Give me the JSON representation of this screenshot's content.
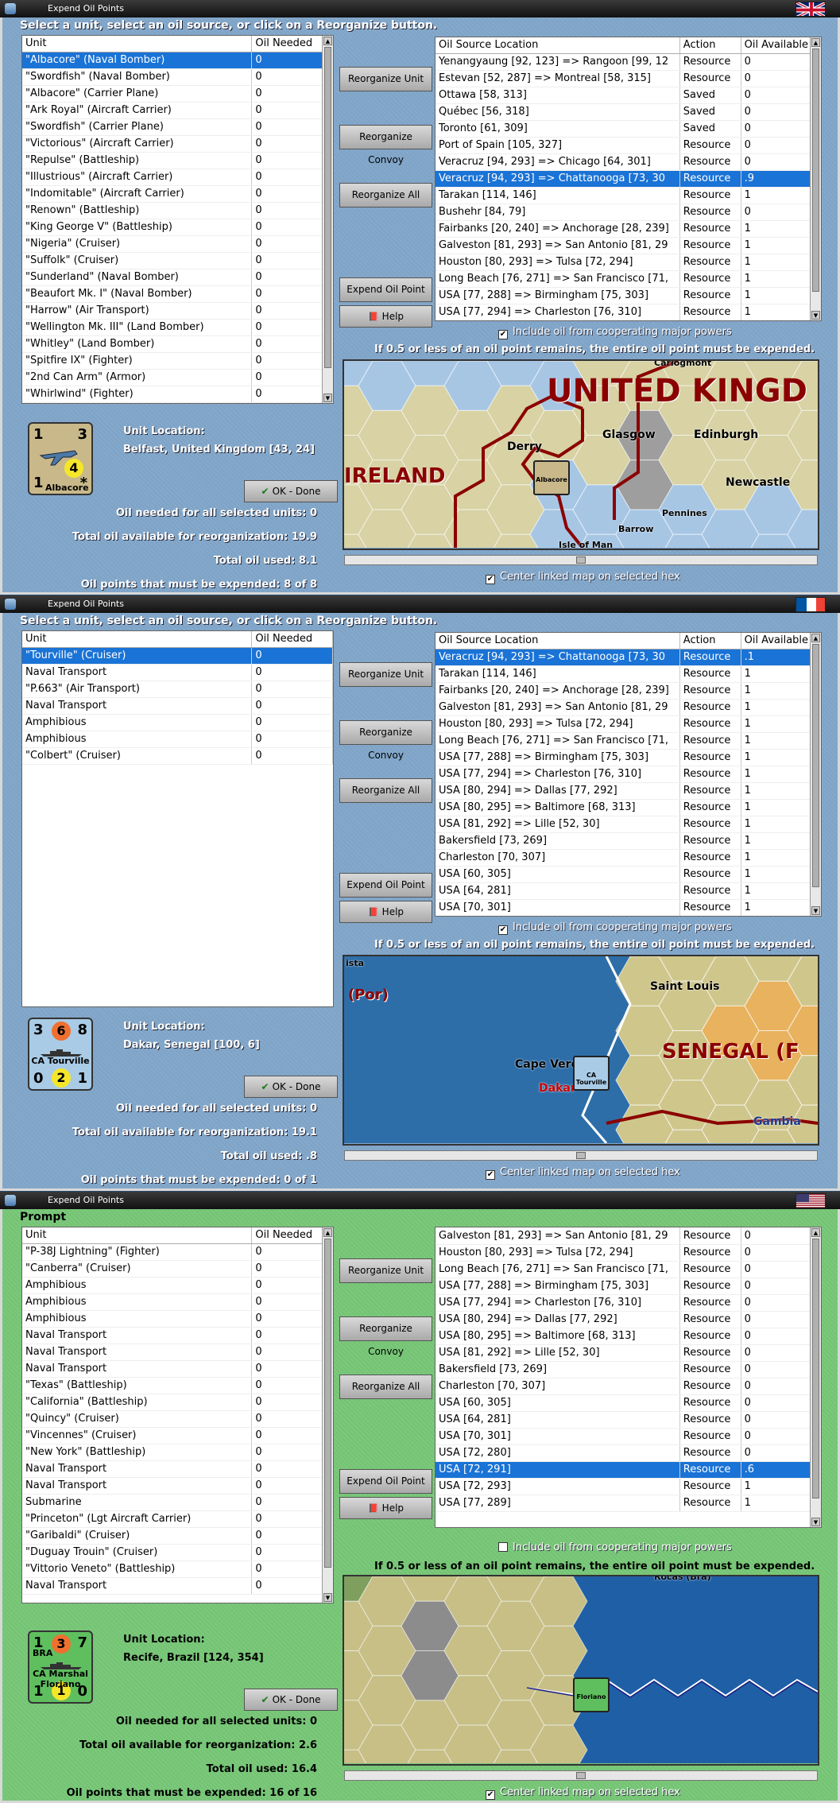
{
  "dialogs": [
    {
      "title": "Expend Oil Points",
      "flag": "uk",
      "prompt": "Select a unit, select an oil source, or click on a Reorganize button.",
      "unit_columns": [
        "Unit",
        "Oil Needed"
      ],
      "units": [
        [
          "\"Albacore\" (Naval Bomber)",
          "0"
        ],
        [
          "\"Swordfish\" (Naval Bomber)",
          "0"
        ],
        [
          "\"Albacore\" (Carrier Plane)",
          "0"
        ],
        [
          "\"Ark Royal\" (Aircraft Carrier)",
          "0"
        ],
        [
          "\"Swordfish\" (Carrier Plane)",
          "0"
        ],
        [
          "\"Victorious\" (Aircraft Carrier)",
          "0"
        ],
        [
          "\"Repulse\" (Battleship)",
          "0"
        ],
        [
          "\"Illustrious\" (Aircraft Carrier)",
          "0"
        ],
        [
          "\"Indomitable\" (Aircraft Carrier)",
          "0"
        ],
        [
          "\"Renown\" (Battleship)",
          "0"
        ],
        [
          "\"King George V\" (Battleship)",
          "0"
        ],
        [
          "\"Nigeria\" (Cruiser)",
          "0"
        ],
        [
          "\"Suffolk\" (Cruiser)",
          "0"
        ],
        [
          "\"Sunderland\" (Naval Bomber)",
          "0"
        ],
        [
          "\"Beaufort Mk. I\" (Naval Bomber)",
          "0"
        ],
        [
          "\"Harrow\" (Air Transport)",
          "0"
        ],
        [
          "\"Wellington Mk. III\" (Land Bomber)",
          "0"
        ],
        [
          "\"Whitley\" (Land Bomber)",
          "0"
        ],
        [
          "\"Spitfire IX\" (Fighter)",
          "0"
        ],
        [
          "\"2nd Can Arm\" (Armor)",
          "0"
        ],
        [
          "\"Whirlwind\" (Fighter)",
          "0"
        ]
      ],
      "selected_unit": 0,
      "source_columns": [
        "Oil Source Location",
        "Action",
        "Oil Available"
      ],
      "sources": [
        [
          "Yenangyaung [92, 123] => Rangoon [99, 12",
          "Resource",
          "0"
        ],
        [
          "Estevan [52, 287] => Montreal [58, 315]",
          "Resource",
          "0"
        ],
        [
          "Ottawa [58, 313]",
          "Saved",
          "0"
        ],
        [
          "Québec [56, 318]",
          "Saved",
          "0"
        ],
        [
          "Toronto [61, 309]",
          "Saved",
          "0"
        ],
        [
          "Port of Spain [105, 327]",
          "Resource",
          "0"
        ],
        [
          "Veracruz [94, 293] => Chicago [64, 301]",
          "Resource",
          "0"
        ],
        [
          "Veracruz [94, 293] => Chattanooga [73, 30",
          "Resource",
          ".9"
        ],
        [
          "Tarakan [114, 146]",
          "Resource",
          "1"
        ],
        [
          "Bushehr [84, 79]",
          "Resource",
          "0"
        ],
        [
          "Fairbanks [20, 240] => Anchorage [28, 239]",
          "Resource",
          "1"
        ],
        [
          "Galveston [81, 293] => San Antonio [81, 29",
          "Resource",
          "1"
        ],
        [
          "Houston [80, 293] => Tulsa [72, 294]",
          "Resource",
          "1"
        ],
        [
          "Long Beach [76, 271] => San Francisco [71,",
          "Resource",
          "1"
        ],
        [
          "USA [77, 288] => Birmingham [75, 303]",
          "Resource",
          "1"
        ],
        [
          "USA [77, 294] => Charleston [76, 310]",
          "Resource",
          "1"
        ]
      ],
      "selected_source": 7,
      "buttons": {
        "reorganize_unit": "Reorganize Unit",
        "reorganize_convoy": "Reorganize Convoy",
        "reorganize_all": "Reorganize All",
        "expend_oil_point": "Expend Oil Point",
        "help": "Help",
        "ok_done": "OK - Done"
      },
      "include_coop": {
        "label": "Include oil from cooperating major powers",
        "checked": true
      },
      "warning": "If 0.5 or less of an oil point remains, the entire oil point must be expended.",
      "center_map": {
        "label": "Center linked map on selected hex",
        "checked": true
      },
      "unit_location_label": "Unit Location:",
      "unit_location": "Belfast, United Kingdom [43, 24]",
      "counter": {
        "tl": "1",
        "tr": "3",
        "mid": "4",
        "bl": "1",
        "name": "Albacore",
        "br": "*",
        "color": "#c9b98a",
        "kind": "plane"
      },
      "stats": [
        {
          "label": "Oil needed for all selected units:",
          "value": "0"
        },
        {
          "label": "Total oil available for reorganization:",
          "value": "19.9"
        },
        {
          "label": "Total oil used:",
          "value": "8.1"
        },
        {
          "label": "Oil points that must be expended:",
          "value": "8 of 8"
        }
      ],
      "map_labels": {
        "big": "UNITED KINGD",
        "region": "IRELAND",
        "cities": [
          "Derry",
          "Glasgow",
          "Edinburgh",
          "Newcastle",
          "Pennines",
          "Barrow",
          "Isle of Man",
          "Carlogmont"
        ],
        "counter_name": "Albacore"
      }
    },
    {
      "title": "Expend Oil Points",
      "flag": "france",
      "prompt": "Select a unit, select an oil source, or click on a Reorganize button.",
      "unit_columns": [
        "Unit",
        "Oil Needed"
      ],
      "units": [
        [
          "\"Tourville\" (Cruiser)",
          "0"
        ],
        [
          "Naval Transport",
          "0"
        ],
        [
          "\"P.663\" (Air Transport)",
          "0"
        ],
        [
          "Naval Transport",
          "0"
        ],
        [
          "Amphibious",
          "0"
        ],
        [
          "Amphibious",
          "0"
        ],
        [
          "\"Colbert\" (Cruiser)",
          "0"
        ]
      ],
      "selected_unit": 0,
      "source_columns": [
        "Oil Source Location",
        "Action",
        "Oil Available"
      ],
      "sources": [
        [
          "Veracruz [94, 293] => Chattanooga [73, 30",
          "Resource",
          ".1"
        ],
        [
          "Tarakan [114, 146]",
          "Resource",
          "1"
        ],
        [
          "Fairbanks [20, 240] => Anchorage [28, 239]",
          "Resource",
          "1"
        ],
        [
          "Galveston [81, 293] => San Antonio [81, 29",
          "Resource",
          "1"
        ],
        [
          "Houston [80, 293] => Tulsa [72, 294]",
          "Resource",
          "1"
        ],
        [
          "Long Beach [76, 271] => San Francisco [71,",
          "Resource",
          "1"
        ],
        [
          "USA [77, 288] => Birmingham [75, 303]",
          "Resource",
          "1"
        ],
        [
          "USA [77, 294] => Charleston [76, 310]",
          "Resource",
          "1"
        ],
        [
          "USA [80, 294] => Dallas [77, 292]",
          "Resource",
          "1"
        ],
        [
          "USA [80, 295] => Baltimore [68, 313]",
          "Resource",
          "1"
        ],
        [
          "USA [81, 292] => Lille [52, 30]",
          "Resource",
          "1"
        ],
        [
          "Bakersfield [73, 269]",
          "Resource",
          "1"
        ],
        [
          "Charleston [70, 307]",
          "Resource",
          "1"
        ],
        [
          "USA [60, 305]",
          "Resource",
          "1"
        ],
        [
          "USA [64, 281]",
          "Resource",
          "1"
        ],
        [
          "USA [70, 301]",
          "Resource",
          "1"
        ]
      ],
      "selected_source": 0,
      "buttons": {
        "reorganize_unit": "Reorganize Unit",
        "reorganize_convoy": "Reorganize Convoy",
        "reorganize_all": "Reorganize All",
        "expend_oil_point": "Expend Oil Point",
        "help": "Help",
        "ok_done": "OK - Done"
      },
      "include_coop": {
        "label": "Include oil from cooperating major powers",
        "checked": true
      },
      "warning": "If 0.5 or less of an oil point remains, the entire oil point must be expended.",
      "center_map": {
        "label": "Center linked map on selected hex",
        "checked": true
      },
      "unit_location_label": "Unit Location:",
      "unit_location": "Dakar, Senegal [100, 6]",
      "counter": {
        "tl": "3",
        "tr": "8",
        "mid": "6",
        "bl": "0",
        "name": "CA Tourville",
        "br": "1",
        "mid2": "2",
        "color": "#a9cbe6",
        "kind": "ship"
      },
      "stats": [
        {
          "label": "Oil needed for all selected units:",
          "value": "0"
        },
        {
          "label": "Total oil available for reorganization:",
          "value": "19.1"
        },
        {
          "label": "Total oil used:",
          "value": ".8"
        },
        {
          "label": "Oil points that must be expended:",
          "value": "0 of 1"
        }
      ],
      "map_labels": {
        "big": "SENEGAL (F",
        "region": "(Por)",
        "cities": [
          "Saint Louis",
          "Cape Verde",
          "Dakar",
          "Gambia",
          "ista"
        ],
        "counter_name": "CA Tourville"
      }
    },
    {
      "title": "Expend Oil Points",
      "flag": "usa",
      "prompt": "Prompt",
      "unit_columns": [
        "Unit",
        "Oil Needed"
      ],
      "units": [
        [
          "\"P-38J Lightning\" (Fighter)",
          "0"
        ],
        [
          "\"Canberra\" (Cruiser)",
          "0"
        ],
        [
          "Amphibious",
          "0"
        ],
        [
          "Amphibious",
          "0"
        ],
        [
          "Amphibious",
          "0"
        ],
        [
          "Naval Transport",
          "0"
        ],
        [
          "Naval Transport",
          "0"
        ],
        [
          "Naval Transport",
          "0"
        ],
        [
          "\"Texas\" (Battleship)",
          "0"
        ],
        [
          "\"California\" (Battleship)",
          "0"
        ],
        [
          "\"Quincy\" (Cruiser)",
          "0"
        ],
        [
          "\"Vincennes\" (Cruiser)",
          "0"
        ],
        [
          "\"New York\" (Battleship)",
          "0"
        ],
        [
          "Naval Transport",
          "0"
        ],
        [
          "Naval Transport",
          "0"
        ],
        [
          "Submarine",
          "0"
        ],
        [
          "\"Princeton\" (Lgt Aircraft Carrier)",
          "0"
        ],
        [
          "\"Garibaldi\" (Cruiser)",
          "0"
        ],
        [
          "\"Duguay Trouin\" (Cruiser)",
          "0"
        ],
        [
          "\"Vittorio Veneto\" (Battleship)",
          "0"
        ],
        [
          "Naval Transport",
          "0"
        ]
      ],
      "selected_unit": -1,
      "source_columns": [
        "Oil Source Location",
        "Action",
        "Oil Available"
      ],
      "sources": [
        [
          "Galveston [81, 293] => San Antonio [81, 29",
          "Resource",
          "0"
        ],
        [
          "Houston [80, 293] => Tulsa [72, 294]",
          "Resource",
          "0"
        ],
        [
          "Long Beach [76, 271] => San Francisco [71,",
          "Resource",
          "0"
        ],
        [
          "USA [77, 288] => Birmingham [75, 303]",
          "Resource",
          "0"
        ],
        [
          "USA [77, 294] => Charleston [76, 310]",
          "Resource",
          "0"
        ],
        [
          "USA [80, 294] => Dallas [77, 292]",
          "Resource",
          "0"
        ],
        [
          "USA [80, 295] => Baltimore [68, 313]",
          "Resource",
          "0"
        ],
        [
          "USA [81, 292] => Lille [52, 30]",
          "Resource",
          "0"
        ],
        [
          "Bakersfield [73, 269]",
          "Resource",
          "0"
        ],
        [
          "Charleston [70, 307]",
          "Resource",
          "0"
        ],
        [
          "USA [60, 305]",
          "Resource",
          "0"
        ],
        [
          "USA [64, 281]",
          "Resource",
          "0"
        ],
        [
          "USA [70, 301]",
          "Resource",
          "0"
        ],
        [
          "USA [72, 280]",
          "Resource",
          "0"
        ],
        [
          "USA [72, 291]",
          "Resource",
          ".6"
        ],
        [
          "USA [72, 293]",
          "Resource",
          "1"
        ],
        [
          "USA [77, 289]",
          "Resource",
          "1"
        ]
      ],
      "selected_source": 14,
      "buttons": {
        "reorganize_unit": "Reorganize Unit",
        "reorganize_convoy": "Reorganize Convoy",
        "reorganize_all": "Reorganize All",
        "expend_oil_point": "Expend Oil Point",
        "help": "Help",
        "ok_done": "OK - Done"
      },
      "include_coop": {
        "label": "Include oil from cooperating major powers",
        "checked": false
      },
      "warning": "If 0.5 or less of an oil point remains, the entire oil point must be expended.",
      "center_map": {
        "label": "Center linked map on selected hex",
        "checked": true
      },
      "unit_location_label": "Unit Location:",
      "unit_location": "Recife, Brazil [124, 354]",
      "counter": {
        "tl": "1",
        "tr": "7",
        "mid": "3",
        "bl": "1",
        "name": "CA Marshal Floriano",
        "br": "0",
        "mid2": "1",
        "top": "BRA",
        "color": "#5fbf5f",
        "kind": "ship"
      },
      "stats": [
        {
          "label": "Oil needed for all selected units:",
          "value": "0"
        },
        {
          "label": "Total oil available for reorganization:",
          "value": "2.6"
        },
        {
          "label": "Total oil used:",
          "value": "16.4"
        },
        {
          "label": "Oil points that must be expended:",
          "value": "16 of 16"
        }
      ],
      "map_labels": {
        "big": "",
        "region": "",
        "cities": [
          "Rocas (Bra)"
        ],
        "counter_name": "Floriano"
      }
    }
  ]
}
